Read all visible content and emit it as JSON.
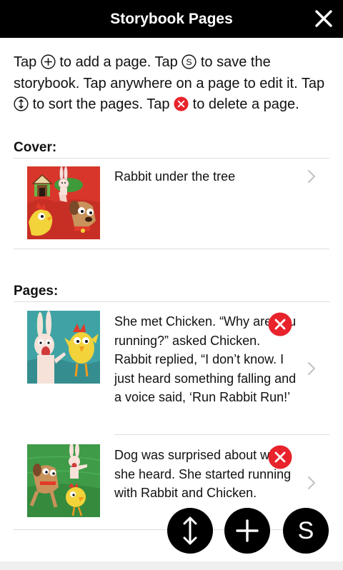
{
  "header": {
    "title": "Storybook Pages",
    "close_icon": "close-icon"
  },
  "instructions": {
    "p1": "Tap",
    "p2": "to add a page. Tap",
    "p3": "to save the storybook. Tap anywhere on a page to edit it. Tap",
    "p4": "to sort the pages. Tap",
    "p5": "to delete a page."
  },
  "cover": {
    "label": "Cover:",
    "item": {
      "text": "Rabbit under the tree",
      "thumb_icon": "rabbit-under-tree-illustration"
    }
  },
  "pages": {
    "label": "Pages:",
    "items": [
      {
        "text": "She met Chicken. “Why are you running?” asked Chicken. Rabbit replied, “I don’t know. I just heard something falling and a voice said, ‘Run Rabbit Run!’",
        "thumb_icon": "rabbit-and-chicken-illustration"
      },
      {
        "text": "Dog was surprised about what she heard. She started running with Rabbit and Chicken.",
        "thumb_icon": "dog-rabbit-chicken-running-illustration"
      }
    ]
  },
  "fabs": {
    "sort_icon": "sort-arrows-icon",
    "add_icon": "plus-icon",
    "save_label": "S"
  },
  "colors": {
    "delete_red": "#e8232c",
    "bar": "#000000"
  }
}
